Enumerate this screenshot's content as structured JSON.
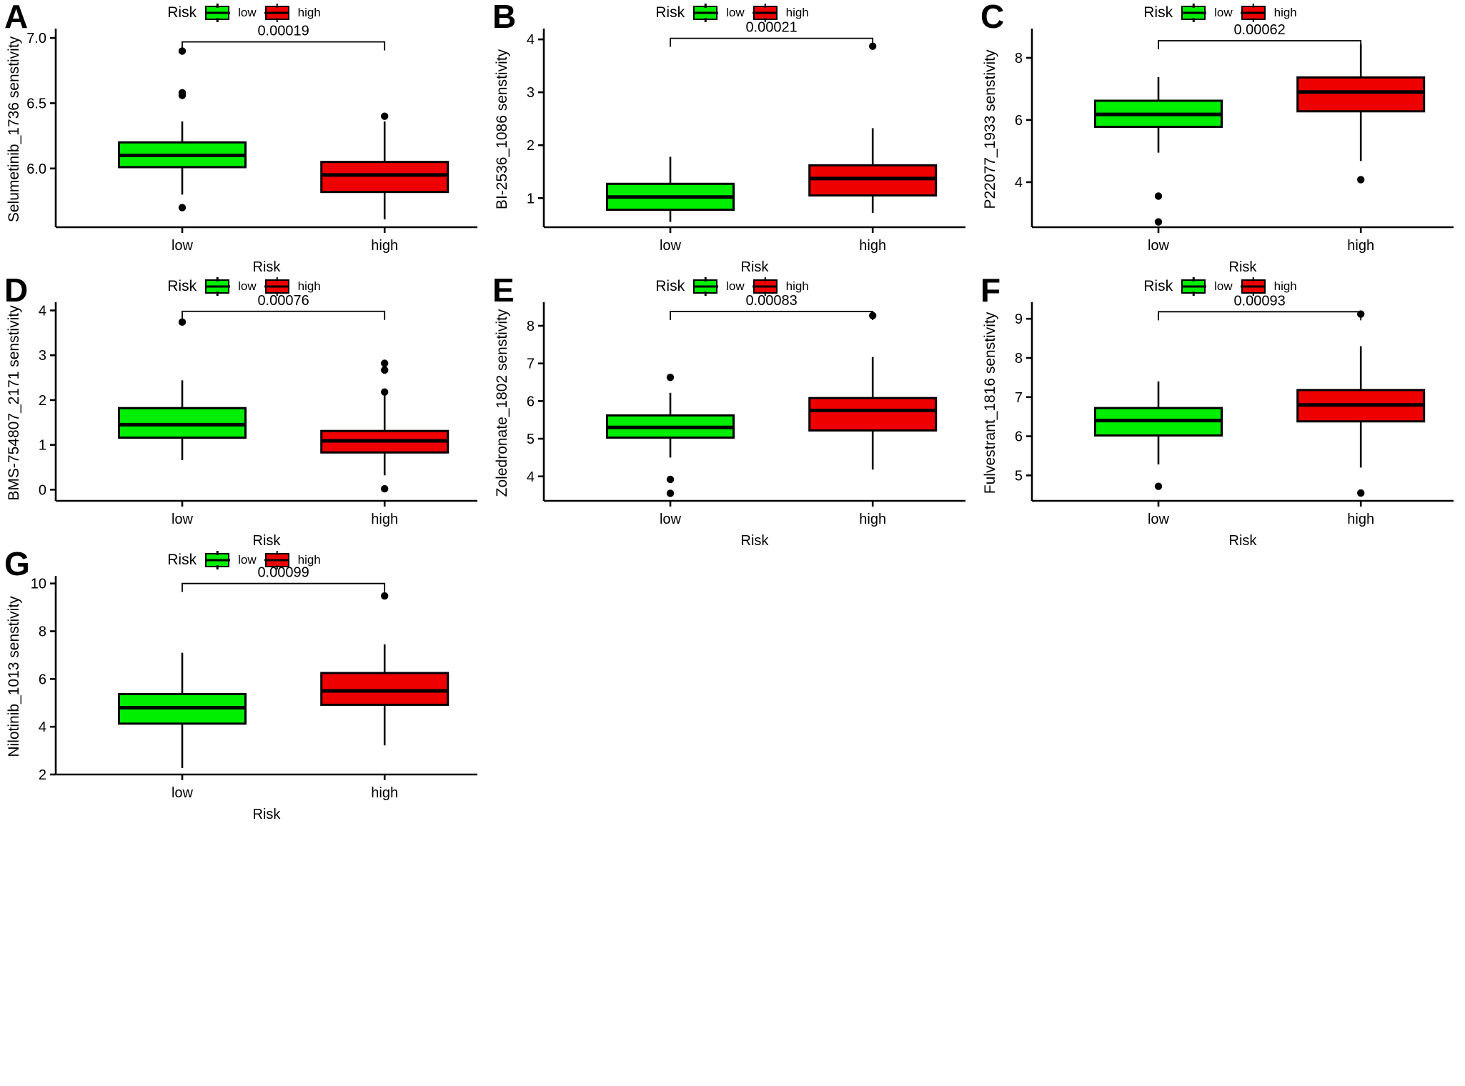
{
  "figure": {
    "panel_count": 7,
    "legend": {
      "title": "Risk",
      "low_label": "low",
      "high_label": "high"
    },
    "colors": {
      "low": "#00ee00",
      "high": "#ee0000",
      "outline": "#000000"
    },
    "xlabel": "Risk",
    "xticks": [
      "low",
      "high"
    ]
  },
  "chart_data": [
    {
      "panel": "A",
      "type": "box",
      "title": "",
      "ylabel": "Selumetinib_1736 senstivity",
      "xlabel": "Risk",
      "categories": [
        "low",
        "high"
      ],
      "ylim": [
        5.55,
        7.05
      ],
      "yticks": [
        6.0,
        6.5,
        7.0
      ],
      "ytick_labels": [
        "6.0",
        "6.5",
        "7.0"
      ],
      "pvalue": "0.00019",
      "bracket_y": 6.97,
      "legend": {
        "title": "Risk",
        "entries": [
          "low",
          "high"
        ]
      },
      "boxes": [
        {
          "group": "low",
          "color": "#00ee00",
          "min": 5.8,
          "q1": 6.01,
          "median": 6.1,
          "q3": 6.2,
          "max": 6.36,
          "outliers": [
            6.9,
            6.58,
            6.56,
            5.7
          ]
        },
        {
          "group": "high",
          "color": "#ee0000",
          "min": 5.61,
          "q1": 5.82,
          "median": 5.95,
          "q3": 6.05,
          "max": 6.36,
          "outliers": [
            6.4
          ]
        }
      ]
    },
    {
      "panel": "B",
      "type": "box",
      "title": "",
      "ylabel": "BI-2536_1086 senstivity",
      "xlabel": "Risk",
      "categories": [
        "low",
        "high"
      ],
      "ylim": [
        0.45,
        4.15
      ],
      "yticks": [
        1,
        2,
        3,
        4
      ],
      "ytick_labels": [
        "1",
        "2",
        "3",
        "4"
      ],
      "pvalue": "0.00021",
      "bracket_y": 4.02,
      "legend": {
        "title": "Risk",
        "entries": [
          "low",
          "high"
        ]
      },
      "boxes": [
        {
          "group": "low",
          "color": "#00ee00",
          "min": 0.55,
          "q1": 0.78,
          "median": 1.02,
          "q3": 1.27,
          "max": 1.78,
          "outliers": []
        },
        {
          "group": "high",
          "color": "#ee0000",
          "min": 0.72,
          "q1": 1.05,
          "median": 1.37,
          "q3": 1.62,
          "max": 2.32,
          "outliers": [
            3.87
          ]
        }
      ]
    },
    {
      "panel": "C",
      "type": "box",
      "title": "",
      "ylabel": "P22077_1933 senstivity",
      "xlabel": "Risk",
      "categories": [
        "low",
        "high"
      ],
      "ylim": [
        2.55,
        8.85
      ],
      "yticks": [
        4,
        6,
        8
      ],
      "ytick_labels": [
        "4",
        "6",
        "8"
      ],
      "pvalue": "0.00062",
      "bracket_y": 8.55,
      "legend": {
        "title": "Risk",
        "entries": [
          "low",
          "high"
        ]
      },
      "boxes": [
        {
          "group": "low",
          "color": "#00ee00",
          "min": 4.95,
          "q1": 5.78,
          "median": 6.18,
          "q3": 6.62,
          "max": 7.38,
          "outliers": [
            3.55,
            2.72
          ]
        },
        {
          "group": "high",
          "color": "#ee0000",
          "min": 4.68,
          "q1": 6.28,
          "median": 6.9,
          "q3": 7.37,
          "max": 8.45,
          "outliers": [
            4.08
          ]
        }
      ]
    },
    {
      "panel": "D",
      "type": "box",
      "title": "",
      "ylabel": "BMS-754807_2171 senstivity",
      "xlabel": "Risk",
      "categories": [
        "low",
        "high"
      ],
      "ylim": [
        -0.25,
        4.12
      ],
      "yticks": [
        0,
        1,
        2,
        3,
        4
      ],
      "ytick_labels": [
        "0",
        "1",
        "2",
        "3",
        "4"
      ],
      "pvalue": "0.00076",
      "bracket_y": 3.98,
      "legend": {
        "title": "Risk",
        "entries": [
          "low",
          "high"
        ]
      },
      "boxes": [
        {
          "group": "low",
          "color": "#00ee00",
          "min": 0.66,
          "q1": 1.16,
          "median": 1.45,
          "q3": 1.82,
          "max": 2.44,
          "outliers": [
            3.74
          ]
        },
        {
          "group": "high",
          "color": "#ee0000",
          "min": 0.32,
          "q1": 0.83,
          "median": 1.09,
          "q3": 1.31,
          "max": 2.1,
          "outliers": [
            2.82,
            2.67,
            2.18,
            0.02
          ]
        }
      ]
    },
    {
      "panel": "E",
      "type": "box",
      "title": "",
      "ylabel": "Zoledronate_1802 senstivity",
      "xlabel": "Risk",
      "categories": [
        "low",
        "high"
      ],
      "ylim": [
        3.35,
        8.55
      ],
      "yticks": [
        4,
        5,
        6,
        7,
        8
      ],
      "ytick_labels": [
        "4",
        "5",
        "6",
        "7",
        "8"
      ],
      "pvalue": "0.00083",
      "bracket_y": 8.38,
      "legend": {
        "title": "Risk",
        "entries": [
          "low",
          "high"
        ]
      },
      "boxes": [
        {
          "group": "low",
          "color": "#00ee00",
          "min": 4.5,
          "q1": 5.03,
          "median": 5.3,
          "q3": 5.62,
          "max": 6.22,
          "outliers": [
            6.63,
            3.92,
            3.55
          ]
        },
        {
          "group": "high",
          "color": "#ee0000",
          "min": 4.18,
          "q1": 5.22,
          "median": 5.75,
          "q3": 6.08,
          "max": 7.17,
          "outliers": [
            8.27
          ]
        }
      ]
    },
    {
      "panel": "F",
      "type": "box",
      "title": "",
      "ylabel": "Fulvestrant_1816 senstivity",
      "xlabel": "Risk",
      "categories": [
        "low",
        "high"
      ],
      "ylim": [
        4.35,
        9.35
      ],
      "yticks": [
        5,
        6,
        7,
        8,
        9
      ],
      "ytick_labels": [
        "5",
        "6",
        "7",
        "8",
        "9"
      ],
      "pvalue": "0.00093",
      "bracket_y": 9.18,
      "legend": {
        "title": "Risk",
        "entries": [
          "low",
          "high"
        ]
      },
      "boxes": [
        {
          "group": "low",
          "color": "#00ee00",
          "min": 5.28,
          "q1": 6.02,
          "median": 6.4,
          "q3": 6.72,
          "max": 7.4,
          "outliers": [
            4.72
          ]
        },
        {
          "group": "high",
          "color": "#ee0000",
          "min": 5.2,
          "q1": 6.38,
          "median": 6.8,
          "q3": 7.18,
          "max": 8.3,
          "outliers": [
            9.12,
            4.55
          ]
        }
      ]
    },
    {
      "panel": "G",
      "type": "box",
      "title": "",
      "ylabel": "Nilotinib_1013 senstivity",
      "xlabel": "Risk",
      "categories": [
        "low",
        "high"
      ],
      "ylim": [
        2.0,
        10.2
      ],
      "yticks": [
        2,
        4,
        6,
        8,
        10
      ],
      "ytick_labels": [
        "2",
        "4",
        "6",
        "8",
        "10"
      ],
      "pvalue": "0.00099",
      "bracket_y": 10.0,
      "legend": {
        "title": "Risk",
        "entries": [
          "low",
          "high"
        ]
      },
      "boxes": [
        {
          "group": "low",
          "color": "#00ee00",
          "min": 2.27,
          "q1": 4.13,
          "median": 4.8,
          "q3": 5.37,
          "max": 7.1,
          "outliers": []
        },
        {
          "group": "high",
          "color": "#ee0000",
          "min": 3.22,
          "q1": 4.92,
          "median": 5.5,
          "q3": 6.25,
          "max": 7.45,
          "outliers": [
            9.48
          ]
        }
      ]
    }
  ]
}
